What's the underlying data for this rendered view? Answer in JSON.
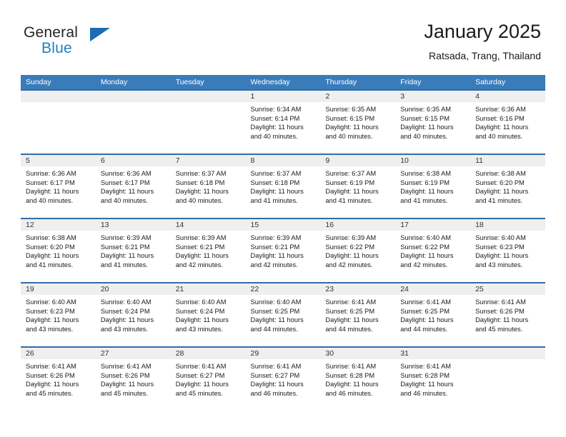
{
  "brand": {
    "name_part1": "General",
    "name_part2": "Blue",
    "logo_icon": "triangle-logo-icon"
  },
  "header": {
    "title": "January 2025",
    "subtitle": "Ratsada, Trang, Thailand"
  },
  "colors": {
    "header_blue": "#3a7cba",
    "cell_border_blue": "#2f6ea8",
    "day_band_gray": "#efefef",
    "brand_blue": "#1f7fc4",
    "text_dark": "#1a1a1a"
  },
  "weekdays": [
    "Sunday",
    "Monday",
    "Tuesday",
    "Wednesday",
    "Thursday",
    "Friday",
    "Saturday"
  ],
  "weeks": [
    [
      {
        "day": "",
        "sunrise": "",
        "sunset": "",
        "daylight1": "",
        "daylight2": ""
      },
      {
        "day": "",
        "sunrise": "",
        "sunset": "",
        "daylight1": "",
        "daylight2": ""
      },
      {
        "day": "",
        "sunrise": "",
        "sunset": "",
        "daylight1": "",
        "daylight2": ""
      },
      {
        "day": "1",
        "sunrise": "Sunrise: 6:34 AM",
        "sunset": "Sunset: 6:14 PM",
        "daylight1": "Daylight: 11 hours",
        "daylight2": "and 40 minutes."
      },
      {
        "day": "2",
        "sunrise": "Sunrise: 6:35 AM",
        "sunset": "Sunset: 6:15 PM",
        "daylight1": "Daylight: 11 hours",
        "daylight2": "and 40 minutes."
      },
      {
        "day": "3",
        "sunrise": "Sunrise: 6:35 AM",
        "sunset": "Sunset: 6:15 PM",
        "daylight1": "Daylight: 11 hours",
        "daylight2": "and 40 minutes."
      },
      {
        "day": "4",
        "sunrise": "Sunrise: 6:36 AM",
        "sunset": "Sunset: 6:16 PM",
        "daylight1": "Daylight: 11 hours",
        "daylight2": "and 40 minutes."
      }
    ],
    [
      {
        "day": "5",
        "sunrise": "Sunrise: 6:36 AM",
        "sunset": "Sunset: 6:17 PM",
        "daylight1": "Daylight: 11 hours",
        "daylight2": "and 40 minutes."
      },
      {
        "day": "6",
        "sunrise": "Sunrise: 6:36 AM",
        "sunset": "Sunset: 6:17 PM",
        "daylight1": "Daylight: 11 hours",
        "daylight2": "and 40 minutes."
      },
      {
        "day": "7",
        "sunrise": "Sunrise: 6:37 AM",
        "sunset": "Sunset: 6:18 PM",
        "daylight1": "Daylight: 11 hours",
        "daylight2": "and 40 minutes."
      },
      {
        "day": "8",
        "sunrise": "Sunrise: 6:37 AM",
        "sunset": "Sunset: 6:18 PM",
        "daylight1": "Daylight: 11 hours",
        "daylight2": "and 41 minutes."
      },
      {
        "day": "9",
        "sunrise": "Sunrise: 6:37 AM",
        "sunset": "Sunset: 6:19 PM",
        "daylight1": "Daylight: 11 hours",
        "daylight2": "and 41 minutes."
      },
      {
        "day": "10",
        "sunrise": "Sunrise: 6:38 AM",
        "sunset": "Sunset: 6:19 PM",
        "daylight1": "Daylight: 11 hours",
        "daylight2": "and 41 minutes."
      },
      {
        "day": "11",
        "sunrise": "Sunrise: 6:38 AM",
        "sunset": "Sunset: 6:20 PM",
        "daylight1": "Daylight: 11 hours",
        "daylight2": "and 41 minutes."
      }
    ],
    [
      {
        "day": "12",
        "sunrise": "Sunrise: 6:38 AM",
        "sunset": "Sunset: 6:20 PM",
        "daylight1": "Daylight: 11 hours",
        "daylight2": "and 41 minutes."
      },
      {
        "day": "13",
        "sunrise": "Sunrise: 6:39 AM",
        "sunset": "Sunset: 6:21 PM",
        "daylight1": "Daylight: 11 hours",
        "daylight2": "and 41 minutes."
      },
      {
        "day": "14",
        "sunrise": "Sunrise: 6:39 AM",
        "sunset": "Sunset: 6:21 PM",
        "daylight1": "Daylight: 11 hours",
        "daylight2": "and 42 minutes."
      },
      {
        "day": "15",
        "sunrise": "Sunrise: 6:39 AM",
        "sunset": "Sunset: 6:21 PM",
        "daylight1": "Daylight: 11 hours",
        "daylight2": "and 42 minutes."
      },
      {
        "day": "16",
        "sunrise": "Sunrise: 6:39 AM",
        "sunset": "Sunset: 6:22 PM",
        "daylight1": "Daylight: 11 hours",
        "daylight2": "and 42 minutes."
      },
      {
        "day": "17",
        "sunrise": "Sunrise: 6:40 AM",
        "sunset": "Sunset: 6:22 PM",
        "daylight1": "Daylight: 11 hours",
        "daylight2": "and 42 minutes."
      },
      {
        "day": "18",
        "sunrise": "Sunrise: 6:40 AM",
        "sunset": "Sunset: 6:23 PM",
        "daylight1": "Daylight: 11 hours",
        "daylight2": "and 43 minutes."
      }
    ],
    [
      {
        "day": "19",
        "sunrise": "Sunrise: 6:40 AM",
        "sunset": "Sunset: 6:23 PM",
        "daylight1": "Daylight: 11 hours",
        "daylight2": "and 43 minutes."
      },
      {
        "day": "20",
        "sunrise": "Sunrise: 6:40 AM",
        "sunset": "Sunset: 6:24 PM",
        "daylight1": "Daylight: 11 hours",
        "daylight2": "and 43 minutes."
      },
      {
        "day": "21",
        "sunrise": "Sunrise: 6:40 AM",
        "sunset": "Sunset: 6:24 PM",
        "daylight1": "Daylight: 11 hours",
        "daylight2": "and 43 minutes."
      },
      {
        "day": "22",
        "sunrise": "Sunrise: 6:40 AM",
        "sunset": "Sunset: 6:25 PM",
        "daylight1": "Daylight: 11 hours",
        "daylight2": "and 44 minutes."
      },
      {
        "day": "23",
        "sunrise": "Sunrise: 6:41 AM",
        "sunset": "Sunset: 6:25 PM",
        "daylight1": "Daylight: 11 hours",
        "daylight2": "and 44 minutes."
      },
      {
        "day": "24",
        "sunrise": "Sunrise: 6:41 AM",
        "sunset": "Sunset: 6:25 PM",
        "daylight1": "Daylight: 11 hours",
        "daylight2": "and 44 minutes."
      },
      {
        "day": "25",
        "sunrise": "Sunrise: 6:41 AM",
        "sunset": "Sunset: 6:26 PM",
        "daylight1": "Daylight: 11 hours",
        "daylight2": "and 45 minutes."
      }
    ],
    [
      {
        "day": "26",
        "sunrise": "Sunrise: 6:41 AM",
        "sunset": "Sunset: 6:26 PM",
        "daylight1": "Daylight: 11 hours",
        "daylight2": "and 45 minutes."
      },
      {
        "day": "27",
        "sunrise": "Sunrise: 6:41 AM",
        "sunset": "Sunset: 6:26 PM",
        "daylight1": "Daylight: 11 hours",
        "daylight2": "and 45 minutes."
      },
      {
        "day": "28",
        "sunrise": "Sunrise: 6:41 AM",
        "sunset": "Sunset: 6:27 PM",
        "daylight1": "Daylight: 11 hours",
        "daylight2": "and 45 minutes."
      },
      {
        "day": "29",
        "sunrise": "Sunrise: 6:41 AM",
        "sunset": "Sunset: 6:27 PM",
        "daylight1": "Daylight: 11 hours",
        "daylight2": "and 46 minutes."
      },
      {
        "day": "30",
        "sunrise": "Sunrise: 6:41 AM",
        "sunset": "Sunset: 6:28 PM",
        "daylight1": "Daylight: 11 hours",
        "daylight2": "and 46 minutes."
      },
      {
        "day": "31",
        "sunrise": "Sunrise: 6:41 AM",
        "sunset": "Sunset: 6:28 PM",
        "daylight1": "Daylight: 11 hours",
        "daylight2": "and 46 minutes."
      },
      {
        "day": "",
        "sunrise": "",
        "sunset": "",
        "daylight1": "",
        "daylight2": ""
      }
    ]
  ]
}
